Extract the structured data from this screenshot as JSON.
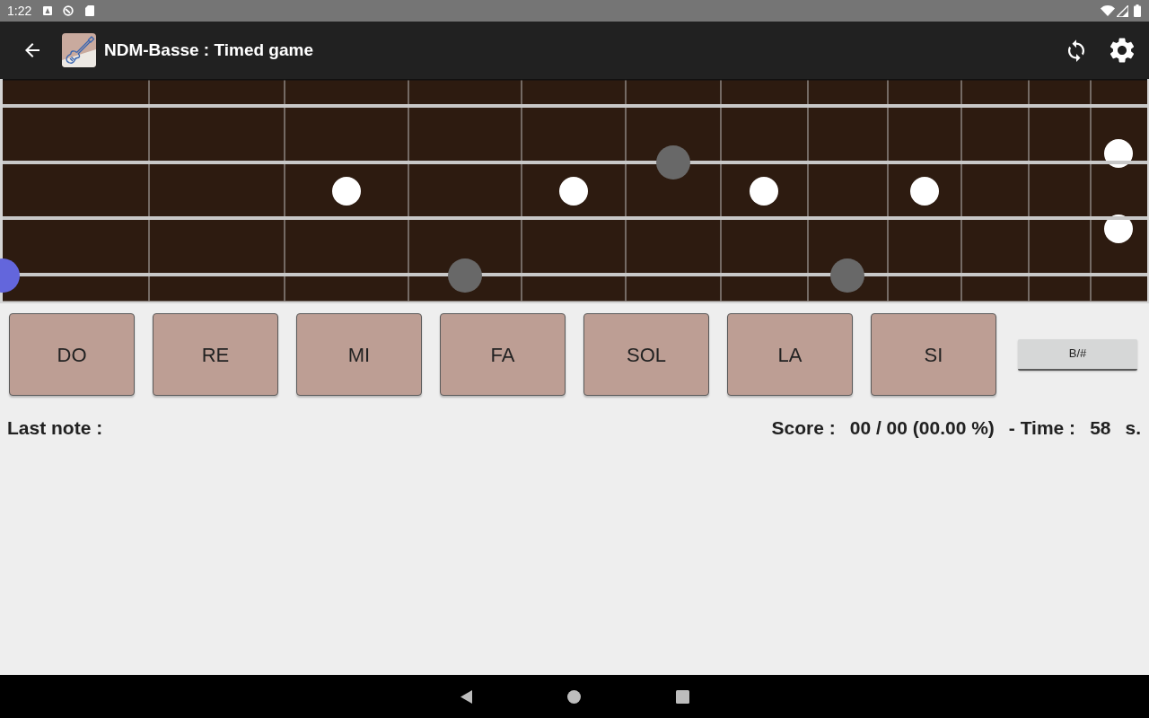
{
  "status_bar": {
    "time": "1:22"
  },
  "app_bar": {
    "title": "NDM-Basse : Timed game"
  },
  "note_buttons": [
    {
      "label": "DO"
    },
    {
      "label": "RE"
    },
    {
      "label": "MI"
    },
    {
      "label": "FA"
    },
    {
      "label": "SOL"
    },
    {
      "label": "LA"
    },
    {
      "label": "SI"
    }
  ],
  "accidental_button": {
    "label": "B/#"
  },
  "info": {
    "last_note_label": "Last note :",
    "score_label": "Score :",
    "score": "00 / 00 (00.00 %)",
    "time_label": "- Time :",
    "time": "58",
    "time_unit": "s."
  }
}
